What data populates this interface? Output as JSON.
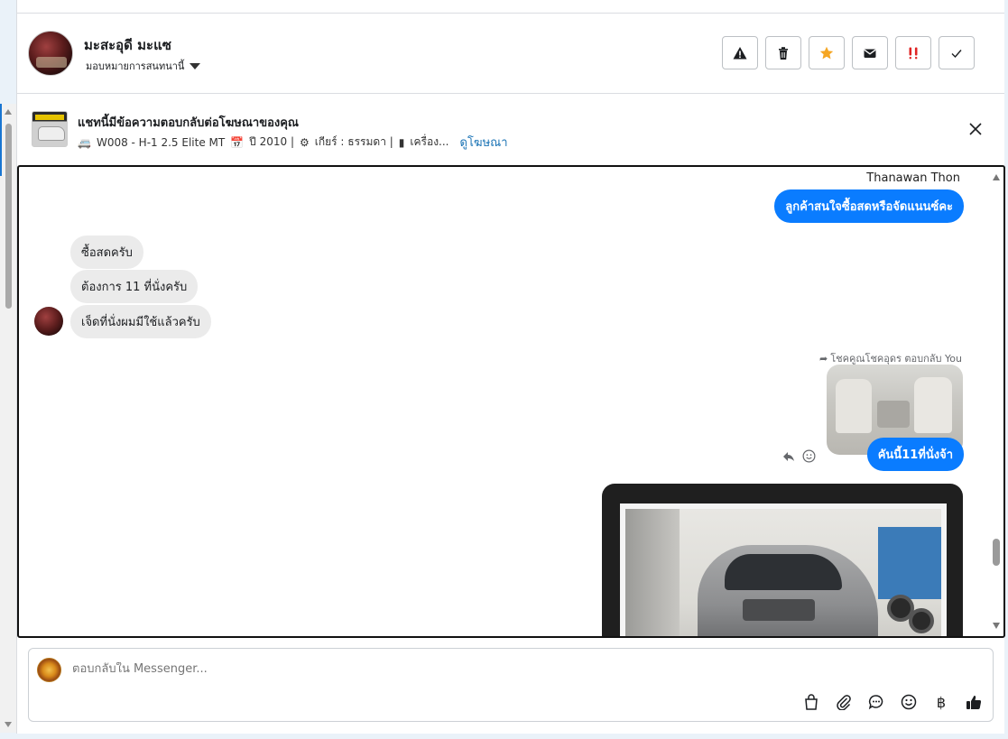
{
  "header": {
    "contact_name": "มะสะอุดี มะแซ",
    "assign_label": "มอบหมายการสนทนานี้",
    "actions": [
      "warning-icon",
      "trash-icon",
      "star-icon",
      "envelope-icon",
      "spam-icon",
      "check-icon"
    ]
  },
  "ad": {
    "title": "แชทนี้มีข้อความตอบกลับต่อโฆษณาของคุณ",
    "subtitle": "W008 - H-1 2.5 Elite MT",
    "year": "ปี 2010 |",
    "gear": "เกียร์ : ธรรมดา |",
    "engine": "เครื่อง...",
    "view_ad": "ดูโฆษณา"
  },
  "conversation": {
    "sender_name": "Thanawan Thon",
    "msg_out_1": "ลูกค้าสนใจซื้อสดหรือจัดแนนซ์คะ",
    "msg_in_1": "ซื้อสดครับ",
    "msg_in_2": "ต้องการ 11 ที่นั่งครับ",
    "msg_in_3": "เจ็ดที่นั่งผมมีใช้แล้วครับ",
    "reply_note": "โชคคูณโชคอุดร ตอบกลับ You",
    "msg_out_2": "คันนี้11ที่นั่งจ้า"
  },
  "composer": {
    "placeholder": "ตอบกลับใน Messenger...",
    "tools": [
      "shopping-bag-icon",
      "paperclip-icon",
      "chat-bubble-icon",
      "emoji-icon",
      "baht-icon",
      "thumbs-up-icon"
    ],
    "baht_symbol": "฿"
  },
  "colors": {
    "accent": "#0a7cff",
    "link": "#1a73b5",
    "star": "#f5a623",
    "spam": "#e02424"
  }
}
